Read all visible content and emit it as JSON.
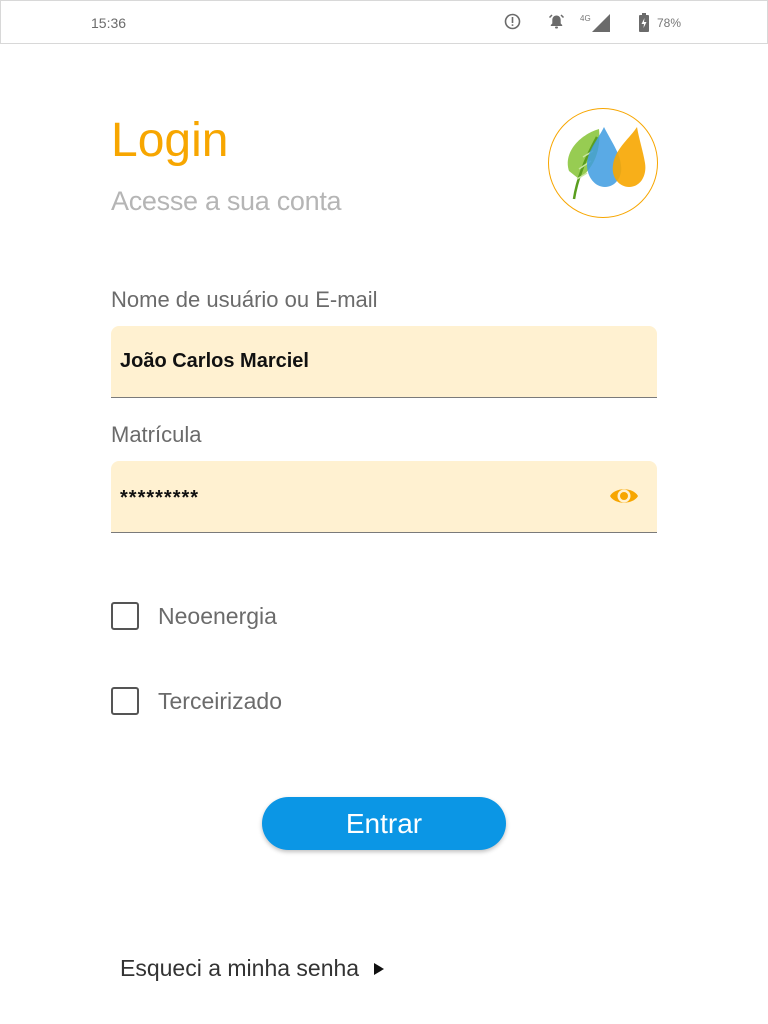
{
  "status_bar": {
    "time": "15:36",
    "network": "4G",
    "battery": "78%",
    "icons": [
      "alert-circle-icon",
      "alarm-bell-icon",
      "signal-icon",
      "battery-charging-icon"
    ]
  },
  "header": {
    "title": "Login",
    "subtitle": "Acesse a sua conta",
    "logo": "neoenergia-leaf-drops-logo"
  },
  "form": {
    "username": {
      "label": "Nome de usuário ou E-mail",
      "value": "João Carlos Marciel"
    },
    "registration": {
      "label": "Matrícula",
      "value": "*********",
      "toggle_icon": "eye-icon"
    },
    "options": [
      {
        "label": "Neoenergia",
        "checked": false
      },
      {
        "label": "Terceirizado",
        "checked": false
      }
    ],
    "submit_label": "Entrar",
    "forgot_label": "Esqueci a minha senha"
  },
  "colors": {
    "accent": "#f7a600",
    "field_bg": "#fff1d1",
    "button": "#0b96e5",
    "label": "#6b6b6b"
  }
}
